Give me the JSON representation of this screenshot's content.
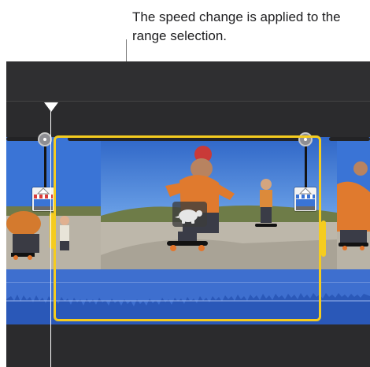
{
  "callout": {
    "text": "The speed change is applied to the range selection."
  },
  "icons": {
    "playhead": "playhead-triangle-icon",
    "speed_handle": "speed-handle-icon",
    "clapper": "clapperboard-icon",
    "turtle": "turtle-slow-motion-icon"
  },
  "colors": {
    "selection": "#f5cc1f",
    "audio": "#3e6fcf",
    "timeline_bg": "#2b2b2d"
  }
}
